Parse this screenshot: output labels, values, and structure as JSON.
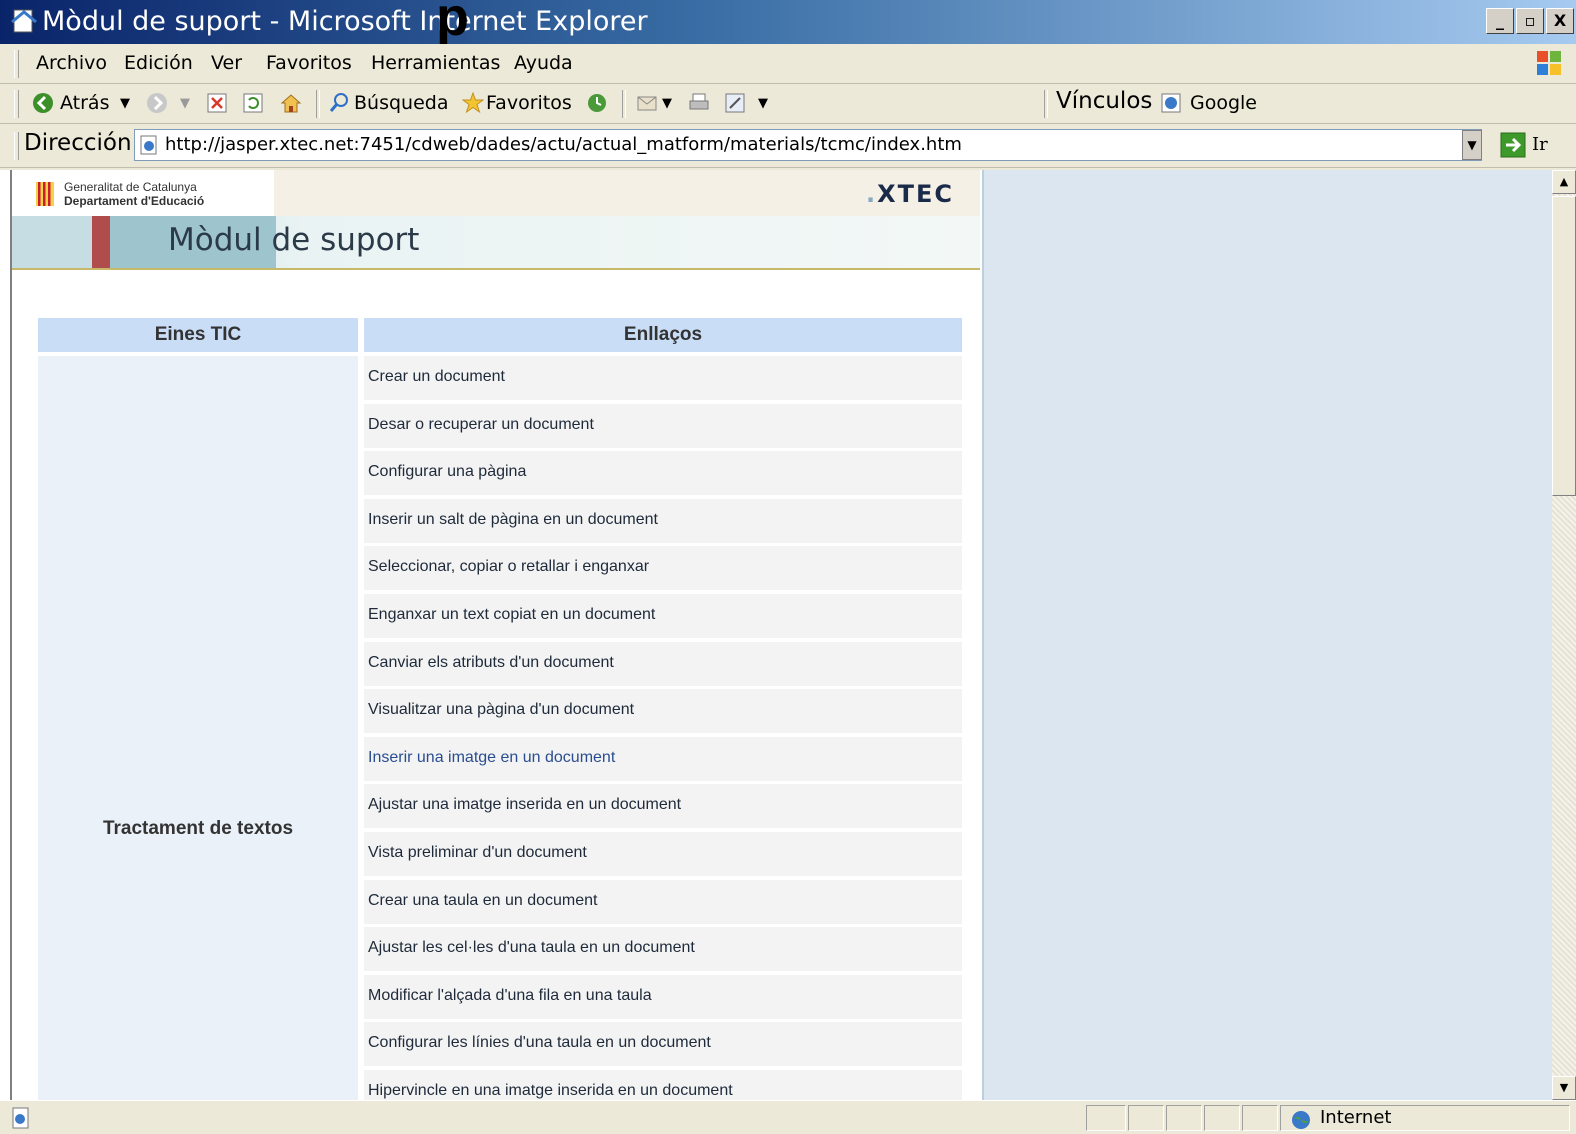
{
  "window": {
    "title": "Mòdul de suport - Microsoft Internet Explorer",
    "title_overlay": "p",
    "controls": [
      "_",
      "▫",
      "X"
    ]
  },
  "menu": {
    "items": [
      "Archivo",
      "Edición",
      "Ver",
      "Favoritos",
      "Herramientas",
      "Ayuda"
    ]
  },
  "toolbar": {
    "back_label": "Atrás",
    "search_label": "Búsqueda",
    "favorites_label": "Favoritos",
    "links_label": "Vínculos",
    "google_label": "Google"
  },
  "address": {
    "label": "Dirección",
    "url": "http://jasper.xtec.net:7451/cdweb/dades/actu/actual_matform/materials/tcmc/index.htm",
    "go_label": "Ir"
  },
  "page": {
    "gencat_line1": "Generalitat de Catalunya",
    "gencat_line2": "Departament d'Educació",
    "xtec_dot": ".",
    "xtec": "XTEC",
    "module_title": "Mòdul de suport",
    "table": {
      "col_tools": "Eines TIC",
      "col_links": "Enllaços",
      "category": "Tractament de textos",
      "links": [
        "Crear un document",
        "Desar o recuperar un document",
        "Configurar una pàgina",
        "Inserir un salt de pàgina en un document",
        "Seleccionar, copiar o retallar i enganxar",
        "Enganxar un text copiat en un document",
        "Canviar els atributs d'un document",
        "Visualitzar una pàgina d'un document",
        "Inserir una imatge en un document",
        "Ajustar una imatge inserida en un document",
        "Vista preliminar d'un document",
        "Crear una taula en un document",
        "Ajustar les cel·les d'una taula en un document",
        "Modificar l'alçada d'una fila en una taula",
        "Configurar les línies d'una taula en un document",
        "Hipervincle en una imatge inserida en un document"
      ]
    }
  },
  "status": {
    "zone": "Internet"
  },
  "colors": {
    "title_gradient_start": "#0a246a",
    "header_blue": "#c9ddf6",
    "banner_red": "#b04c4c",
    "visited_link": "#2a4d8f"
  }
}
